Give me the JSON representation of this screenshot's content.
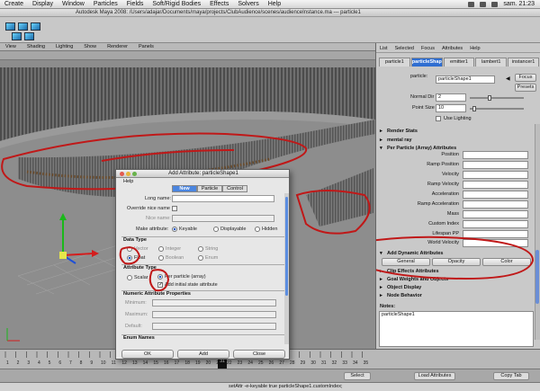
{
  "menubar": {
    "items": [
      "Create",
      "Display",
      "Window",
      "Particles",
      "Fields",
      "Soft/Rigid Bodies",
      "Effects",
      "Solvers",
      "Help"
    ],
    "clock": "sam. 21:23"
  },
  "titlebar": {
    "title": "Autodesk Maya 2008: /Users/adajar/Documents/maya/projects/ClubAudience/scenes/audienceInstance.ma    ---    particle1"
  },
  "viewport": {
    "menu": [
      "View",
      "Shading",
      "Lighting",
      "Show",
      "Renderer",
      "Panels"
    ]
  },
  "attribute_editor": {
    "menu": [
      "List",
      "Selected",
      "Focus",
      "Attributes",
      "Help"
    ],
    "tabs": [
      "particle1",
      "particleShape1",
      "emitter1",
      "lambert1",
      "instancer1"
    ],
    "active_tab": "particleShape1",
    "node_label": "particle:",
    "node_value": "particleShape1",
    "focus_button": "Focus",
    "presets_button": "Presets",
    "normal_dir_label": "Normal Dir",
    "normal_dir_value": "2",
    "point_size_label": "Point Size",
    "point_size_value": "10",
    "use_lighting_label": "Use Lighting",
    "sections": {
      "render_stats": "Render Stats",
      "mental_ray": "mental ray",
      "per_particle": "Per Particle (Array) Attributes",
      "add_dynamic": "Add Dynamic Attributes",
      "clip_effects": "Clip Effects Attributes",
      "goal_weights": "Goal Weights and Objects",
      "object_display": "Object Display",
      "node_behavior": "Node Behavior"
    },
    "per_particle_attrs": [
      "Position",
      "Ramp Position",
      "Velocity",
      "Ramp Velocity",
      "Acceleration",
      "Ramp Acceleration",
      "Mass",
      "Custom Index",
      "Lifespan PP",
      "World Velocity"
    ],
    "dynamic_buttons": [
      "General",
      "Opacity",
      "Color"
    ],
    "notes_label": "Notes:",
    "notes_value": "particleShape1",
    "bottom_buttons": [
      "Select",
      "Load Attributes",
      "Copy Tab"
    ]
  },
  "dialog": {
    "title": "Add Attribute: particleShape1",
    "help": "Help",
    "tabs": [
      "New",
      "Particle",
      "Control"
    ],
    "active_tab": "New",
    "long_name_label": "Long name:",
    "override_label": "Override nice name",
    "nice_name_label": "Nice name:",
    "make_attr_label": "Make attribute:",
    "make_attr_options": [
      "Keyable",
      "Displayable",
      "Hidden"
    ],
    "data_type_title": "Data Type",
    "data_types": [
      "Vector",
      "Integer",
      "String",
      "Float",
      "Boolean",
      "Enum"
    ],
    "selected_data_type": "Float",
    "attr_type_title": "Attribute Type",
    "scalar_label": "Scalar",
    "per_particle_label": "Per particle (array)",
    "initial_state_label": "Add initial state attribute",
    "numeric_title": "Numeric Attribute Properties",
    "minimum_label": "Minimum:",
    "maximum_label": "Maximum:",
    "default_label": "Default:",
    "enum_title": "Enum Names",
    "buttons": [
      "OK",
      "Add",
      "Close"
    ]
  },
  "timeline": {
    "ticks": [
      "1",
      "2",
      "3",
      "4",
      "5",
      "6",
      "7",
      "8",
      "9",
      "10",
      "11",
      "12",
      "13",
      "14",
      "15",
      "16",
      "17",
      "18",
      "19",
      "20",
      "21",
      "22",
      "23",
      "24",
      "25",
      "26",
      "27",
      "28",
      "29",
      "30",
      "31",
      "32",
      "33",
      "34",
      "35"
    ],
    "current_frame": "31"
  },
  "command_line": "setAttr -e-keyable true particleShape1.customIndex;",
  "colors": {
    "selection_blue": "#2f6ed1",
    "annotation_red": "#c01818",
    "dialog_bg": "#e7e7e7"
  }
}
